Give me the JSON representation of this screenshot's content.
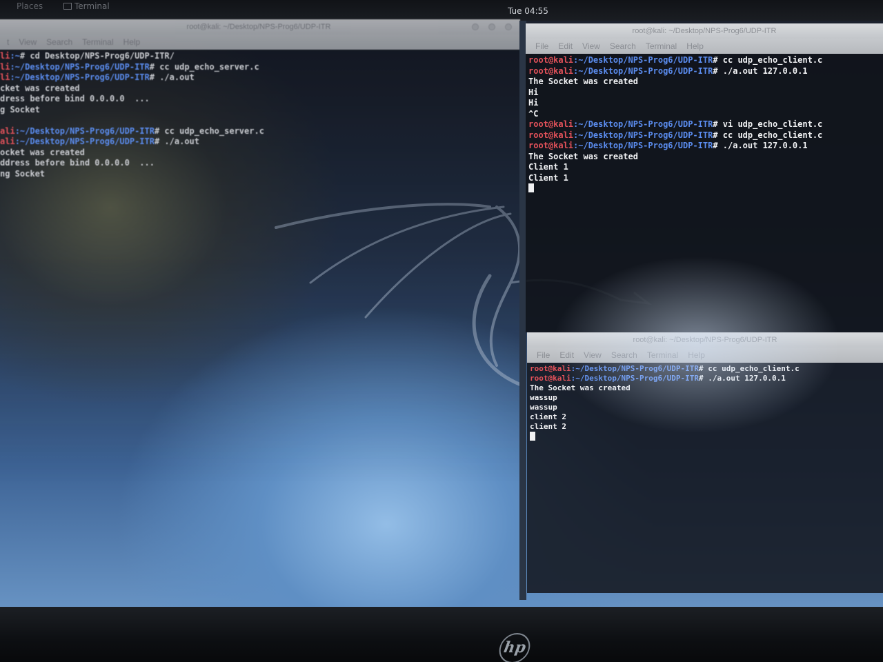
{
  "top_panel": {
    "places_menu": "Places",
    "terminal_menu": "Terminal",
    "clock": "Tue 04:55"
  },
  "left_terminal": {
    "title": "root@kali: ~/Desktop/NPS-Prog6/UDP-ITR",
    "menu": [
      "t",
      "View",
      "Search",
      "Terminal",
      "Help"
    ],
    "lines": [
      {
        "prompt_user": "li",
        "prompt_path": ":~",
        "cmd": "# cd Desktop/NPS-Prog6/UDP-ITR/"
      },
      {
        "prompt_user": "li",
        "prompt_path": ":~/Desktop/NPS-Prog6/UDP-ITR",
        "cmd": "# cc udp_echo_server.c"
      },
      {
        "prompt_user": "li",
        "prompt_path": ":~/Desktop/NPS-Prog6/UDP-ITR",
        "cmd": "# ./a.out"
      },
      {
        "text": "cket was created"
      },
      {
        "text": "dress before bind 0.0.0.0  ..."
      },
      {
        "text": "g Socket"
      },
      {
        "text": ""
      },
      {
        "prompt_user": "ali",
        "prompt_path": ":~/Desktop/NPS-Prog6/UDP-ITR",
        "cmd": "# cc udp_echo_server.c"
      },
      {
        "prompt_user": "ali",
        "prompt_path": ":~/Desktop/NPS-Prog6/UDP-ITR",
        "cmd": "# ./a.out"
      },
      {
        "text": "ocket was created"
      },
      {
        "text": "ddress before bind 0.0.0.0  ..."
      },
      {
        "text": "ng Socket"
      }
    ]
  },
  "right_top_terminal": {
    "title": "root@kali: ~/Desktop/NPS-Prog6/UDP-ITR",
    "menu": [
      "File",
      "Edit",
      "View",
      "Search",
      "Terminal",
      "Help"
    ],
    "lines": [
      {
        "prompt_user": "root@kali",
        "prompt_path": ":~/Desktop/NPS-Prog6/UDP-ITR",
        "cmd": "# cc udp_echo_client.c"
      },
      {
        "prompt_user": "root@kali",
        "prompt_path": ":~/Desktop/NPS-Prog6/UDP-ITR",
        "cmd": "# ./a.out 127.0.0.1"
      },
      {
        "text": "The Socket was created"
      },
      {
        "text": "Hi"
      },
      {
        "text": "Hi"
      },
      {
        "text": "^C"
      },
      {
        "prompt_user": "root@kali",
        "prompt_path": ":~/Desktop/NPS-Prog6/UDP-ITR",
        "cmd": "# vi udp_echo_client.c"
      },
      {
        "prompt_user": "root@kali",
        "prompt_path": ":~/Desktop/NPS-Prog6/UDP-ITR",
        "cmd": "# cc udp_echo_client.c"
      },
      {
        "prompt_user": "root@kali",
        "prompt_path": ":~/Desktop/NPS-Prog6/UDP-ITR",
        "cmd": "# ./a.out 127.0.0.1"
      },
      {
        "text": "The Socket was created"
      },
      {
        "text": "Client 1"
      },
      {
        "text": "Client 1"
      }
    ]
  },
  "right_bottom_terminal": {
    "title": "root@kali: ~/Desktop/NPS-Prog6/UDP-ITR",
    "menu": [
      "File",
      "Edit",
      "View",
      "Search",
      "Terminal",
      "Help"
    ],
    "lines": [
      {
        "prompt_user": "root@kali",
        "prompt_path": ":~/Desktop/NPS-Prog6/UDP-ITR",
        "cmd": "# cc udp_echo_client.c"
      },
      {
        "prompt_user": "root@kali",
        "prompt_path": ":~/Desktop/NPS-Prog6/UDP-ITR",
        "cmd": "# ./a.out 127.0.0.1"
      },
      {
        "text": "The Socket was created"
      },
      {
        "text": "wassup"
      },
      {
        "text": "wassup"
      },
      {
        "text": "client 2"
      },
      {
        "text": "client 2"
      }
    ]
  },
  "bezel": {
    "logo": "hp"
  }
}
